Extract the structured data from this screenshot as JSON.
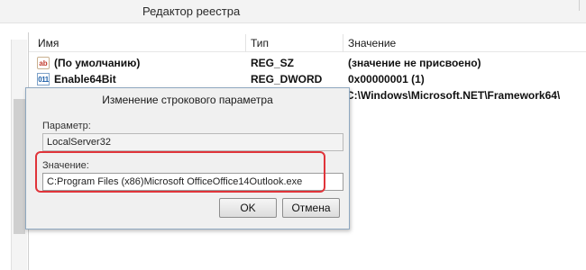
{
  "window": {
    "title": "Редактор реестра"
  },
  "list": {
    "columns": [
      "Имя",
      "Тип",
      "Значение"
    ],
    "rows": [
      {
        "icon": "string-value-icon",
        "icon_text": "ab",
        "name": "(По умолчанию)",
        "type": "REG_SZ",
        "value": "(значение не присвоено)"
      },
      {
        "icon": "binary-value-icon",
        "icon_text": "011 110",
        "name": "Enable64Bit",
        "type": "REG_DWORD",
        "value": "0x00000001 (1)"
      },
      {
        "icon": "",
        "icon_text": "",
        "name": "",
        "type": "",
        "value": "C:\\Windows\\Microsoft.NET\\Framework64\\"
      }
    ]
  },
  "dialog": {
    "title": "Изменение строкового параметра",
    "param_label": "Параметр:",
    "param_value": "LocalServer32",
    "value_label": "Значение:",
    "value_value": "C:Program Files (x86)Microsoft OfficeOffice14Outlook.exe",
    "ok_label": "OK",
    "cancel_label": "Отмена"
  },
  "colors": {
    "highlight": "#e0343a",
    "dialog_border": "#8fa8c0"
  }
}
